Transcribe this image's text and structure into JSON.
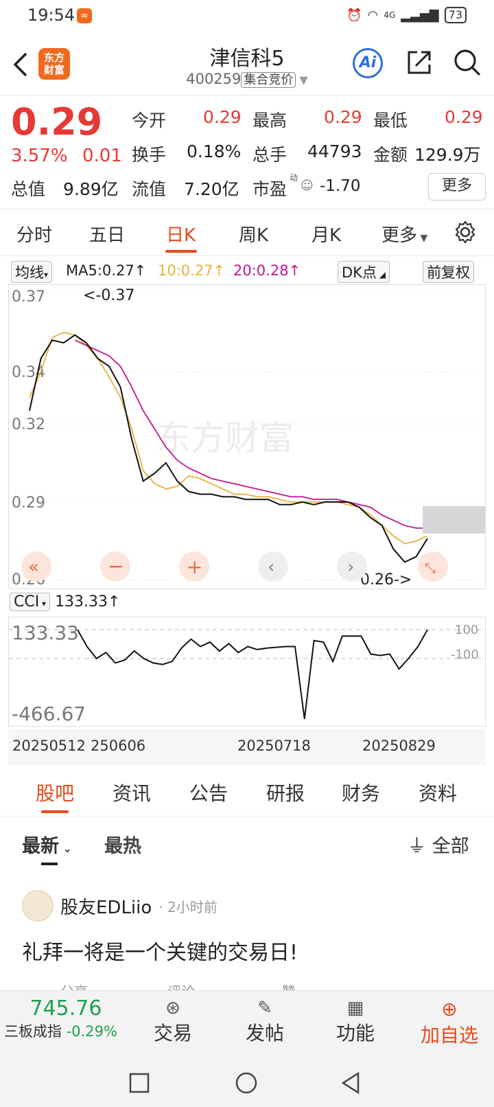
{
  "status": {
    "time": "19:54",
    "battery": "73",
    "signal_label": "4G"
  },
  "header": {
    "title": "津信科5",
    "code": "400259",
    "tag": "集合竞价",
    "logo_line1": "东方",
    "logo_line2": "财富",
    "ai_label": "Ai"
  },
  "quote": {
    "price": "0.29",
    "change_pct": "3.57%",
    "change": "0.01",
    "fields": [
      {
        "label": "今开",
        "value": "0.29"
      },
      {
        "label": "最高",
        "value": "0.29"
      },
      {
        "label": "最低",
        "value": "0.29"
      },
      {
        "label": "换手",
        "value": "0.18%"
      },
      {
        "label": "总手",
        "value": "44793"
      },
      {
        "label": "金额",
        "value": "129.9万"
      },
      {
        "label": "总值",
        "value": "9.89亿"
      },
      {
        "label": "流值",
        "value": "7.20亿"
      },
      {
        "label": "市盈",
        "value": "-1.70"
      }
    ],
    "pe_superscript": "动",
    "more_label": "更多"
  },
  "ktabs": [
    "分时",
    "五日",
    "日K",
    "周K",
    "月K",
    "更多"
  ],
  "ma_legend": {
    "type_label": "均线",
    "ma5": "MA5:0.27↑",
    "ma10": "10:0.27↑",
    "ma20": "20:0.28↑",
    "dk_label": "DK点",
    "adjust_label": "前复权"
  },
  "chart_data": {
    "type": "line",
    "y_ticks": [
      "0.37",
      "0.34",
      "0.32",
      "0.29",
      "0.26"
    ],
    "ylim": [
      0.26,
      0.37
    ],
    "annotations": [
      "<-0.37",
      "0.26->"
    ],
    "watermark": "东方财富",
    "series": [
      {
        "name": "MA5",
        "color": "#e8b13a",
        "values": [
          0.33,
          0.34,
          0.353,
          0.355,
          0.354,
          0.35,
          0.345,
          0.338,
          0.33,
          0.318,
          0.302,
          0.297,
          0.295,
          0.296,
          0.3,
          0.299,
          0.297,
          0.295,
          0.293,
          0.293,
          0.292,
          0.292,
          0.291,
          0.29,
          0.29,
          0.29,
          0.29,
          0.29,
          0.289,
          0.288,
          0.285,
          0.281,
          0.277,
          0.274,
          0.275,
          0.277
        ]
      },
      {
        "name": "MA10",
        "color": "#c2168e",
        "values": [
          null,
          null,
          null,
          null,
          0.352,
          0.35,
          0.348,
          0.346,
          0.342,
          0.334,
          0.325,
          0.318,
          0.311,
          0.306,
          0.303,
          0.301,
          0.299,
          0.298,
          0.297,
          0.296,
          0.295,
          0.294,
          0.293,
          0.292,
          0.292,
          0.291,
          0.291,
          0.291,
          0.29,
          0.289,
          0.288,
          0.285,
          0.283,
          0.281,
          0.28,
          0.28
        ]
      },
      {
        "name": "K",
        "color": "#111111",
        "values": [
          0.325,
          0.345,
          0.352,
          0.351,
          0.354,
          0.351,
          0.345,
          0.342,
          0.334,
          0.314,
          0.298,
          0.301,
          0.305,
          0.298,
          0.294,
          0.293,
          0.293,
          0.292,
          0.292,
          0.291,
          0.291,
          0.291,
          0.289,
          0.289,
          0.29,
          0.289,
          0.29,
          0.29,
          0.29,
          0.288,
          0.284,
          0.281,
          0.272,
          0.267,
          0.269,
          0.276
        ]
      }
    ],
    "cci": {
      "label": "CCI",
      "value_label": "133.33↑",
      "y_max_label": "133.33",
      "y_min_label": "-466.67",
      "ref_high": "100",
      "ref_low": "-100",
      "values": [
        133,
        20,
        -60,
        -20,
        -90,
        -70,
        -10,
        -60,
        -90,
        -100,
        -80,
        10,
        70,
        20,
        50,
        -10,
        40,
        -20,
        20,
        0,
        10,
        15,
        20,
        20,
        -466,
        60,
        50,
        -80,
        90,
        90,
        90,
        -30,
        -40,
        -30,
        -130,
        -60,
        20,
        133
      ]
    },
    "x_labels": [
      "20250512",
      "250606",
      "20250718",
      "20250829"
    ]
  },
  "bottom_tabs": [
    "股吧",
    "资讯",
    "公告",
    "研报",
    "财务",
    "资料"
  ],
  "sort": {
    "latest": "最新",
    "hot": "最热",
    "filter": "全部"
  },
  "post": {
    "user": "股友EDLiio",
    "time": "2小时前",
    "text": "礼拜一将是一个关键的交易日!",
    "actions": [
      "分享",
      "评论",
      "赞"
    ]
  },
  "bottombar": {
    "index_value": "745.76",
    "index_name": "三板成指",
    "index_change": "-0.29%",
    "items": [
      "交易",
      "发帖",
      "功能",
      "加自选"
    ]
  }
}
